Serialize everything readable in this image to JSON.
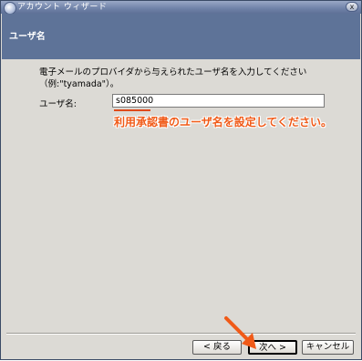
{
  "window": {
    "title": "アカウント ウィザード",
    "close_label": "x"
  },
  "header": {
    "page_title": "ユーザ名"
  },
  "content": {
    "description_line1": "電子メールのプロバイダから与えられたユーザ名を入力してください",
    "description_line2": "（例:\"tyamada\"）。",
    "username_label": "ユーザ名:",
    "username_value": "s085000"
  },
  "annotation": {
    "text": "利用承認書のユーザ名を設定してください。",
    "color": "#f05a18"
  },
  "buttons": {
    "back": "< 戻る",
    "next": "次へ >",
    "cancel": "キャンセル"
  },
  "colors": {
    "header_bg": "#5e7398",
    "window_bg": "#dcdad5",
    "arrow": "#f05a18"
  }
}
